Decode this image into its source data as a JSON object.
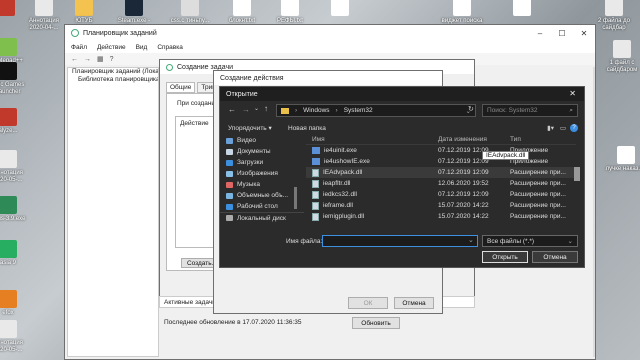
{
  "desktop_top": [
    {
      "label": "",
      "color": "#c0392b"
    },
    {
      "label": "Аннотация 2020-04-...",
      "color": "#e9e9e9"
    },
    {
      "label": "ЮТУБ",
      "color": "#f3c24f"
    },
    {
      "label": "Steam.exe - Ярлык",
      "color": "#1b2838"
    },
    {
      "label": "css.c тиньпу...",
      "color": "#ddd"
    },
    {
      "label": "блокнт.txt",
      "color": "#fff"
    },
    {
      "label": "РЕФЫ.txt",
      "color": "#fff"
    },
    {
      "label": "",
      "color": "#fff"
    },
    {
      "label": "виджет поиска",
      "color": "#fff"
    },
    {
      "label": "",
      "color": "#fff"
    },
    {
      "label": "2 файла до сайдбар",
      "color": "#e9e9e9"
    }
  ],
  "desktop_left": [
    {
      "label": "Notepad++",
      "color": "#7fbf4d"
    },
    {
      "label": "Epic Games Launcher",
      "color": "#111"
    },
    {
      "label": "alyze...",
      "color": "#c0392b"
    },
    {
      "label": "Аннотация 2020-05-...",
      "color": "#e9e9e9"
    },
    {
      "label": "rufus-3.9.exe",
      "color": "#2e8b57"
    },
    {
      "label": "asia 9",
      "color": "#27ae60"
    },
    {
      "label": "efox",
      "color": "#e67e22"
    },
    {
      "label": "Аннотация 2020-05-...",
      "color": "#e9e9e9"
    }
  ],
  "desktop_right": [
    {
      "label": "1 файл с сайдбаром",
      "color": "#e9e9e9"
    },
    {
      "label": "лучке наказ.txt",
      "color": "#fff"
    }
  ],
  "scheduler": {
    "title": "Планировщик заданий",
    "menu": [
      "Файл",
      "Действие",
      "Вид",
      "Справка"
    ],
    "tree": [
      "Планировщик заданий (Локальный)",
      "Библиотека планировщика"
    ],
    "active_tasks_label": "Активные задачи",
    "last_update": "Последнее обновление в 17.07.2020 11:36:35",
    "refresh_button": "Обновить"
  },
  "create_task": {
    "title": "Создание задачи",
    "tabs": [
      "Общие",
      "Тригге"
    ],
    "when_label": "При создании",
    "action_col": "Действие",
    "create_button": "Создать..."
  },
  "create_action": {
    "title": "Создание действия",
    "ok": "ОК",
    "cancel": "Отмена"
  },
  "open_dialog": {
    "title": "Открытие",
    "path": [
      "Windows",
      "System32"
    ],
    "search_placeholder": "Поиск: System32",
    "organize": "Упорядочить ▾",
    "new_folder": "Новая папка",
    "sidebar": [
      {
        "label": "Видео",
        "icon": "video-icon",
        "color": "#6a9fd8"
      },
      {
        "label": "Документы",
        "icon": "documents-icon",
        "color": "#c9d6e3"
      },
      {
        "label": "Загрузки",
        "icon": "downloads-icon",
        "color": "#3d8fe0"
      },
      {
        "label": "Изображения",
        "icon": "pictures-icon",
        "color": "#88c0e8"
      },
      {
        "label": "Музыка",
        "icon": "music-icon",
        "color": "#e06666"
      },
      {
        "label": "Объемные объ...",
        "icon": "3d-objects-icon",
        "color": "#7ab4e0"
      },
      {
        "label": "Рабочий стол",
        "icon": "desktop-icon",
        "color": "#3d8fe0"
      },
      {
        "label": "Локальный диск",
        "icon": "drive-icon",
        "color": "#aaa"
      }
    ],
    "columns": [
      "Имя",
      "Дата изменения",
      "Тип"
    ],
    "files": [
      {
        "name": "ie4uinit.exe",
        "date": "07.12.2019 12:09",
        "type": "Приложение",
        "kind": "exe"
      },
      {
        "name": "ie4ushowIE.exe",
        "date": "07.12.2019 12:09",
        "type": "Приложение",
        "kind": "exe"
      },
      {
        "name": "IEAdvpack.dll",
        "date": "07.12.2019 12:09",
        "type": "Расширение при...",
        "kind": "dll"
      },
      {
        "name": "ieapfltr.dll",
        "date": "12.06.2020 19:52",
        "type": "Расширение при...",
        "kind": "dll"
      },
      {
        "name": "iedkcs32.dll",
        "date": "07.12.2019 12:09",
        "type": "Расширение при...",
        "kind": "dll"
      },
      {
        "name": "ieframe.dll",
        "date": "15.07.2020 14:22",
        "type": "Расширение при...",
        "kind": "dll"
      },
      {
        "name": "iemigplugin.dll",
        "date": "15.07.2020 14:22",
        "type": "Расширение при...",
        "kind": "dll"
      }
    ],
    "tooltip": "IEAdvpack.dll",
    "filename_label": "Имя файла:",
    "filename_value": "",
    "filter": "Все файлы (*.*)",
    "open_button": "Открыть",
    "cancel_button": "Отмена"
  }
}
